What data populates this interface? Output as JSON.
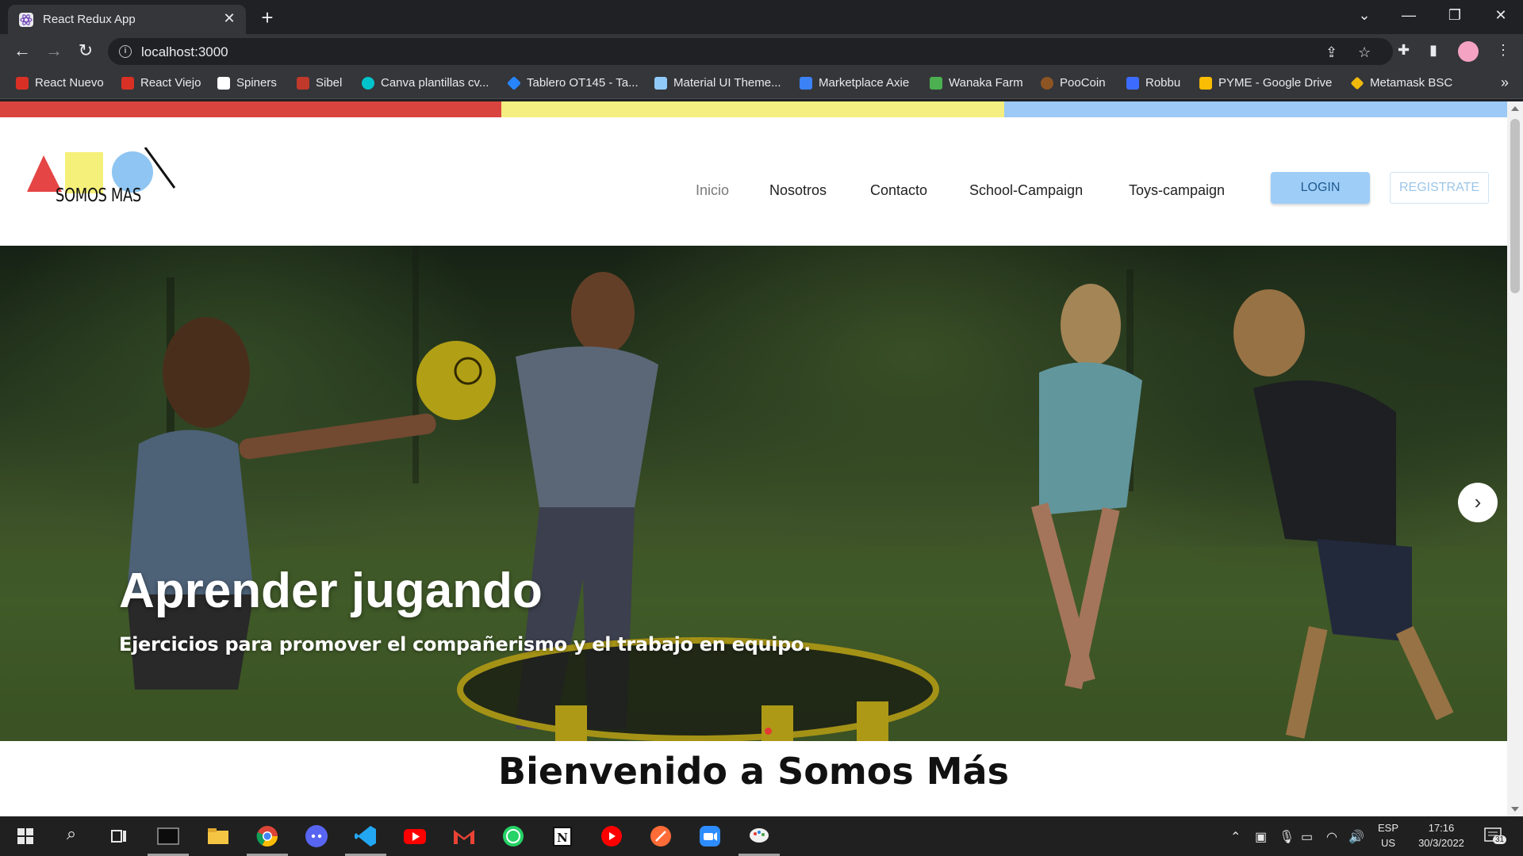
{
  "browser": {
    "tab_title": "React Redux App",
    "url": "localhost:3000",
    "bookmarks": [
      {
        "label": "React Nuevo",
        "color": "#d93025"
      },
      {
        "label": "React Viejo",
        "color": "#d93025"
      },
      {
        "label": "Spiners",
        "color": "#ffffff"
      },
      {
        "label": "Sibel",
        "color": "#c0392b"
      },
      {
        "label": "Canva plantillas cv...",
        "color": "#00c4cc"
      },
      {
        "label": "Tablero OT145 - Ta...",
        "color": "#2684ff"
      },
      {
        "label": "Material UI Theme...",
        "color": "#90caf9"
      },
      {
        "label": "Marketplace Axie",
        "color": "#3b82f6"
      },
      {
        "label": "Wanaka Farm",
        "color": "#4caf50"
      },
      {
        "label": "PooCoin",
        "color": "#8d5524"
      },
      {
        "label": "Robbu",
        "color": "#3b6cff"
      },
      {
        "label": "PYME - Google Drive",
        "color": "#fbbc04"
      },
      {
        "label": "Metamask BSC",
        "color": "#f0b90b"
      }
    ]
  },
  "site": {
    "logo_text": "SOMOS MAS",
    "nav": [
      "Inicio",
      "Nosotros",
      "Contacto",
      "School-Campaign",
      "Toys-campaign"
    ],
    "login_label": "LOGIN",
    "register_label": "REGISTRATE",
    "stripe_colors": [
      "#d9443f",
      "#f5ee80",
      "#9cc9f5"
    ],
    "hero": {
      "title": "Aprender jugando",
      "subtitle": "Ejercicios para promover el compañerismo y el trabajo en equipo."
    },
    "welcome": "Bienvenido a Somos Más"
  },
  "taskbar": {
    "lang_top": "ESP",
    "lang_bottom": "US",
    "time": "17:16",
    "date": "30/3/2022",
    "notifications": "31"
  }
}
